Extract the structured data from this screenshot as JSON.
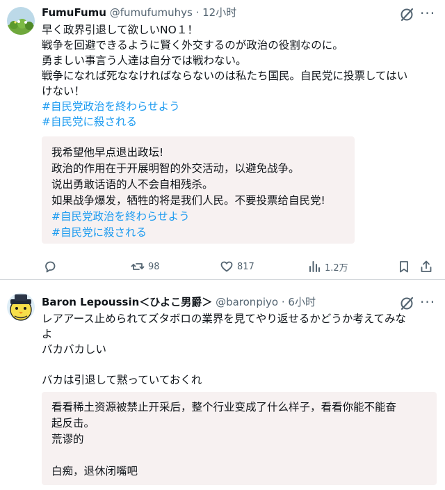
{
  "tweets": [
    {
      "author_name": "FumuFumu",
      "handle": "@fumufumuhys",
      "separator": "·",
      "time": "12小时",
      "lines": [
        "早く政界引退して欲しいNO１！",
        "戦争を回避できるように賢く外交するのが政治の役割なのに。",
        "勇ましい事言う人達は自分では戦わない。",
        "戦争になれば死ななければならないのは私たち国民。自民党に投票してはい",
        "けない！"
      ],
      "hashtags": [
        "#自民党政治を終わらせよう",
        "#自民党に殺される"
      ],
      "translation_lines": [
        "我希望他早点退出政坛!",
        "政治的作用在于开展明智的外交活动，以避免战争。",
        "说出勇敢话语的人不会自相残杀。",
        "如果战争爆发，牺牲的将是我们人民。不要投票给自民党!"
      ],
      "translation_hashtags": [
        "#自民党政治を終わらせよう",
        "#自民党に殺される"
      ],
      "stats": {
        "retweets": "98",
        "likes": "817",
        "views": "1.2万"
      }
    },
    {
      "author_name": "Baron Lepoussin＜ひよこ男爵＞",
      "handle": "@baronpiyo",
      "separator": "·",
      "time": "6小时",
      "lines": [
        "レアアース止められてズタボロの業界を見てやり返せるかどうか考えてみな",
        "よ",
        "バカバカしい",
        "",
        "バカは引退して黙っていておくれ"
      ],
      "translation_lines": [
        "看看稀土资源被禁止开采后，整个行业变成了什么样子，看看你能不能奋",
        "起反击。",
        "荒谬的",
        "",
        "白痴，退休闭嘴吧"
      ]
    }
  ],
  "icons": {
    "grok": "grok-icon",
    "more": "more-icon",
    "reply": "reply-icon",
    "retweet": "retweet-icon",
    "like": "like-icon",
    "views": "views-icon",
    "bookmark": "bookmark-icon",
    "share": "share-icon"
  },
  "colors": {
    "hashtag": "#1d9bf0",
    "secondary_text": "#536471",
    "translation_bg": "#f7f1f1"
  }
}
